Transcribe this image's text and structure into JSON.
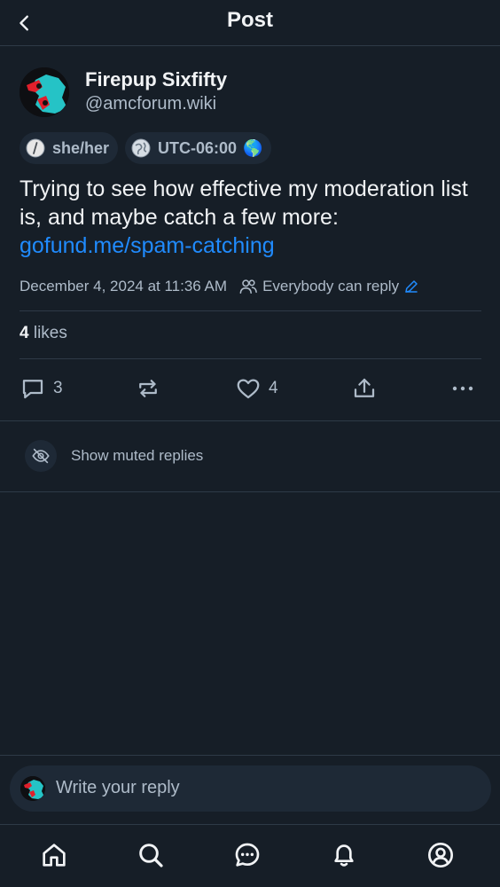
{
  "header": {
    "title": "Post"
  },
  "post": {
    "author": {
      "display_name": "Firepup Sixfifty",
      "handle": "@amcforum.wiki"
    },
    "tags": [
      {
        "icon": "pronoun-slash-icon",
        "label": "she/her"
      },
      {
        "icon": "globe-icon",
        "label": "UTC-06:00",
        "emoji": "🌎"
      }
    ],
    "text": "Trying to see how effective my moderation list is, and maybe catch a few more:",
    "link": "gofund.me/spam-catching",
    "timestamp": "December 4, 2024 at 11:36 AM",
    "reply_setting": "Everybody can reply",
    "likes_count": "4",
    "likes_label": "likes",
    "actions": {
      "reply_count": "3",
      "like_count": "4"
    }
  },
  "muted_replies": {
    "label": "Show muted replies"
  },
  "composer": {
    "placeholder": "Write your reply"
  },
  "tabbar": {
    "items": [
      "home-icon",
      "search-icon",
      "chat-icon",
      "bell-icon",
      "profile-icon"
    ]
  },
  "colors": {
    "background": "#161e27",
    "text": "#f1f3f5",
    "muted_text": "#aebbc9",
    "link": "#208bfe",
    "surface": "#1e2936",
    "divider": "#2e3a47"
  }
}
